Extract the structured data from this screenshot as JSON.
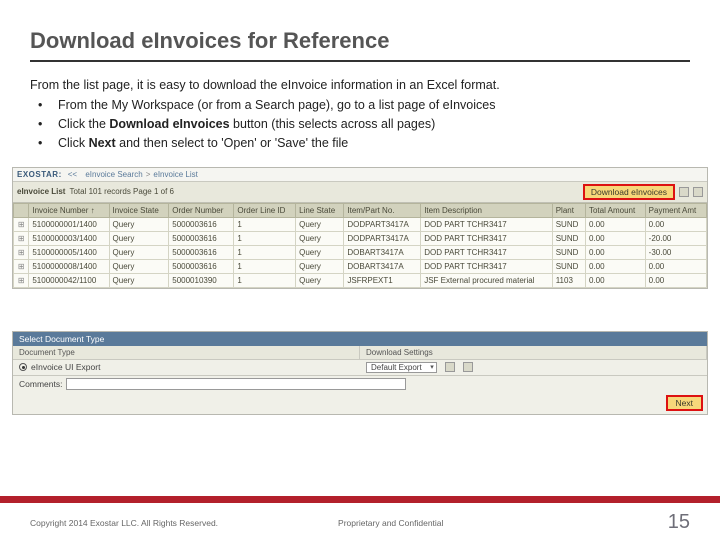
{
  "title": "Download eInvoices for Reference",
  "intro": "From the list page, it is easy to download the eInvoice information in an Excel format.",
  "bullets": [
    {
      "text": "From the My Workspace (or from a Search page), go to a list page of eInvoices"
    },
    {
      "text_pre": "Click the ",
      "bold": "Download eInvoices",
      "text_post": " button (this selects across all pages)"
    },
    {
      "text_pre": "Click ",
      "bold": "Next",
      "text_post": " and then select to 'Open' or 'Save' the file"
    }
  ],
  "shot1": {
    "logo": "EXOSTAR:",
    "breadcrumb_back": "<<",
    "breadcrumb1": "eInvoice Search",
    "breadcrumb_sep": ">",
    "breadcrumb2": "eInvoice List",
    "listhead_label": "eInvoice List",
    "listhead_info": "Total 101 records Page 1 of 6",
    "download_btn": "Download eInvoices",
    "columns": [
      "",
      "Invoice Number ↑",
      "Invoice State",
      "Order Number",
      "Order Line ID",
      "Line State",
      "Item/Part No.",
      "Item Description",
      "Plant",
      "Total Amount",
      "Payment Amt"
    ],
    "rows": [
      [
        "⊞",
        "5100000001/1400",
        "Query",
        "5000003616",
        "1",
        "Query",
        "DODPART3417A",
        "DOD PART TCHR3417",
        "SUND",
        "0.00",
        "0.00"
      ],
      [
        "⊞",
        "5100000003/1400",
        "Query",
        "5000003616",
        "1",
        "Query",
        "DODPART3417A",
        "DOD PART TCHR3417",
        "SUND",
        "0.00",
        "-20.00"
      ],
      [
        "⊞",
        "5100000005/1400",
        "Query",
        "5000003616",
        "1",
        "Query",
        "DOBART3417A",
        "DOD PART TCHR3417",
        "SUND",
        "0.00",
        "-30.00"
      ],
      [
        "⊞",
        "5100000008/1400",
        "Query",
        "5000003616",
        "1",
        "Query",
        "DOBART3417A",
        "DOD PART TCHR3417",
        "SUND",
        "0.00",
        "0.00"
      ],
      [
        "⊞",
        "5100000042/1100",
        "Query",
        "5000010390",
        "1",
        "Query",
        "JSFRPEXT1",
        "JSF External procured material",
        "1103",
        "0.00",
        "0.00"
      ]
    ]
  },
  "shot2": {
    "header": "Select Document Type",
    "col1": "Document Type",
    "col2": "Download Settings",
    "doc_type": "eInvoice UI Export",
    "download_setting": "Default Export",
    "comments_label": "Comments:",
    "comments_value": "",
    "next": "Next"
  },
  "footer": {
    "copyright": "Copyright 2014 Exostar LLC. All Rights Reserved.",
    "confidential": "Proprietary and Confidential",
    "page": "15"
  }
}
